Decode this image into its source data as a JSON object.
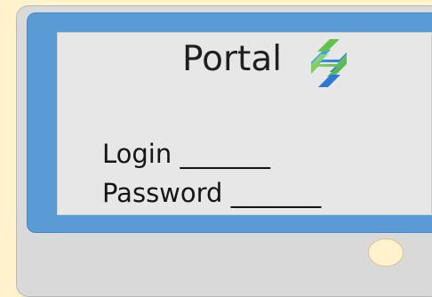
{
  "screen": {
    "title": "Portal",
    "login_label": "Login",
    "login_field": "_______",
    "password_label": "Password",
    "password_field": "_______"
  },
  "icons": {
    "portal_logo": "portal-logo-icon",
    "power_button": "power-button-icon"
  },
  "colors": {
    "background": "#fff2cc",
    "monitor": "#d9d9d9",
    "screen_frame": "#5b9bd5",
    "screen": "#e7e7e7",
    "logo_blue": "#1f6fd1",
    "logo_green": "#63c14c",
    "button": "#fff2cc"
  }
}
